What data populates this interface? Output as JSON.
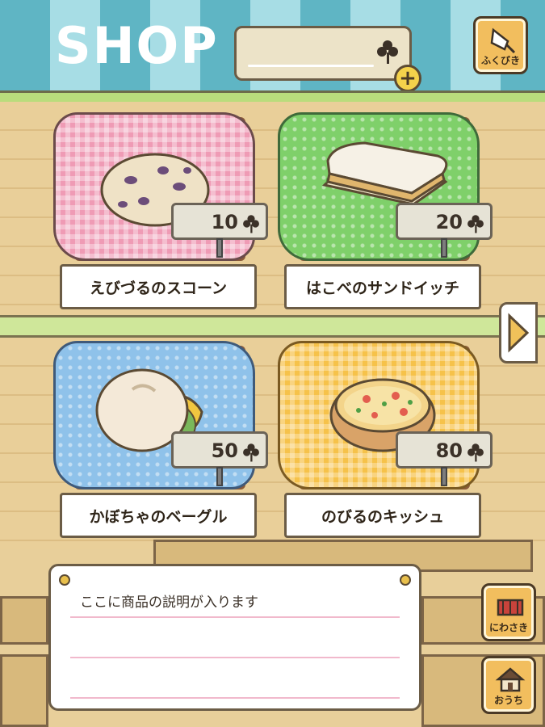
{
  "header": {
    "title": "SHOP",
    "clover_count": "",
    "plus_label": "+",
    "lottery_label": "ふくびき"
  },
  "items": [
    {
      "name": "えびづるのスコーン",
      "price": "10",
      "cloth_color": "#ef9bb5",
      "food": "scone"
    },
    {
      "name": "はこべのサンドイッチ",
      "price": "20",
      "cloth_color": "#7fd06a",
      "food": "sandwich"
    },
    {
      "name": "かぼちゃのベーグル",
      "price": "50",
      "cloth_color": "#8fc2ea",
      "food": "bagel"
    },
    {
      "name": "のびるのキッシュ",
      "price": "80",
      "cloth_color": "#f6c24a",
      "food": "quiche"
    }
  ],
  "description": {
    "text": "ここに商品の説明が入ります"
  },
  "side_buttons": {
    "garden_label": "にわさき",
    "home_label": "おうち"
  },
  "colors": {
    "awning_dark": "#5fb5c4",
    "awning_light": "#a7dde5",
    "shelf": "#cfe79a",
    "wood": "#e9cf99"
  }
}
